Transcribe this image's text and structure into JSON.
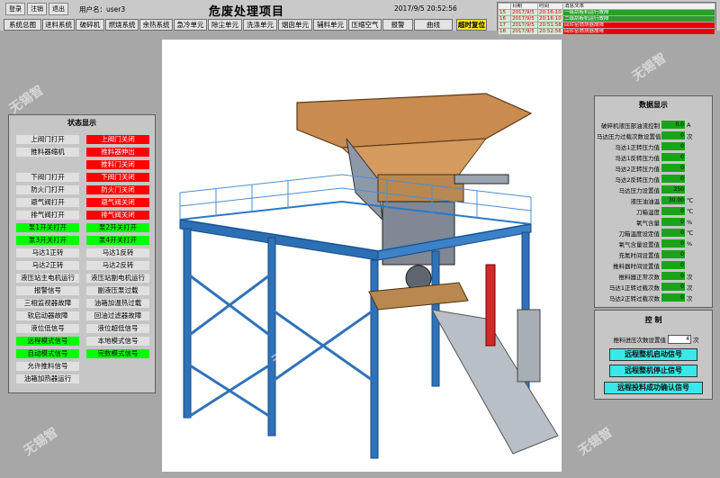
{
  "header": {
    "login": "登录",
    "logout": "注销",
    "exit": "退出",
    "user": "用户名：user3",
    "title": "危废处理项目",
    "datetime": "2017/9/5 20:52:56"
  },
  "nav": [
    "系统总图",
    "进料系统",
    "破碎机",
    "燃烧系统",
    "余热系统",
    "急冷单元",
    "除尘单元",
    "洗涤单元",
    "烟囱单元",
    "辅料单元",
    "压缩空气",
    "报警",
    "曲线",
    "超时复位"
  ],
  "alarms": {
    "headers": [
      "",
      "日期",
      "时间",
      "消息文本"
    ],
    "rows": [
      {
        "num": "15",
        "date": "2017/9/5",
        "time": "20:16:10",
        "msg": "一级刮板机运行故障"
      },
      {
        "num": "16",
        "date": "2017/9/5",
        "time": "20:16:10",
        "msg": "二级刮板机运行故障"
      },
      {
        "num": "17",
        "date": "2017/9/5",
        "time": "20:51:58",
        "msg": "回转窑燃烧器故障"
      },
      {
        "num": "18",
        "date": "2017/9/5",
        "time": "20:52:56",
        "msg": "回转窑燃烧器故障"
      }
    ]
  },
  "status_panel": {
    "title": "状态显示",
    "left": [
      "上阀门打开",
      "推料器缩机",
      "",
      "下阀门打开",
      "防火门打开",
      "避气阀打开",
      "排气阀打开",
      "泵1开关打开",
      "泵3开关打开",
      "马达1正转",
      "马达2正转",
      "液压站主电机运行",
      "报警信号",
      "三相监视器故障",
      "软启动器故障",
      "液位低信号",
      "远程模式信号",
      "自动模式信号",
      "允许推料信号",
      "油箱加热器运行"
    ],
    "right": [
      "上阀门关闭",
      "推料器伸出",
      "推料门关闭",
      "下阀门关闭",
      "防火门关闭",
      "避气阀关闭",
      "排气阀关闭",
      "泵2开关打开",
      "泵4开关打开",
      "马达1反转",
      "马达2反转",
      "液压站副电机运行",
      "副液压泵过载",
      "油箱加温热过载",
      "回油过滤器故障",
      "液位超低信号",
      "本地模式信号",
      "完数模式信号",
      "",
      ""
    ]
  },
  "data_panel": {
    "title": "数据显示",
    "rows": [
      {
        "label": "破碎机液压部油流控制",
        "value": "0.0",
        "unit": "A"
      },
      {
        "label": "马达压力过载次数设置值",
        "value": "0",
        "unit": "次"
      },
      {
        "label": "马达1正转压力值",
        "value": "0",
        "unit": ""
      },
      {
        "label": "马达1反转压力值",
        "value": "0",
        "unit": ""
      },
      {
        "label": "马达2正转压力值",
        "value": "0",
        "unit": ""
      },
      {
        "label": "马达2反转压力值",
        "value": "0",
        "unit": ""
      },
      {
        "label": "马达压力设置值",
        "value": "250",
        "unit": ""
      },
      {
        "label": "液压油油温",
        "value": "30.00",
        "unit": "℃"
      },
      {
        "label": "刀箱温度",
        "value": "0",
        "unit": "℃"
      },
      {
        "label": "氧气含量",
        "value": "0",
        "unit": "%"
      },
      {
        "label": "刀箱温度设定值",
        "value": "0",
        "unit": "℃"
      },
      {
        "label": "氧气含量设置值",
        "value": "0",
        "unit": "%"
      },
      {
        "label": "充氮时间设置值",
        "value": "0",
        "unit": ""
      },
      {
        "label": "推料器时间设置值",
        "value": "0",
        "unit": ""
      },
      {
        "label": "推料器正常次数",
        "value": "0",
        "unit": "次"
      },
      {
        "label": "马达1正转过载次数",
        "value": "0",
        "unit": "次"
      },
      {
        "label": "马达2正转过载次数",
        "value": "0",
        "unit": "次"
      }
    ]
  },
  "control_panel": {
    "title": "控 制",
    "input_label": "推料进压次数设置值",
    "input_value": "4",
    "input_unit": "次",
    "buttons": [
      "远程整机启动信号",
      "远程整机停止信号",
      "远程投料成功确认信号"
    ]
  },
  "watermark": "无锡智"
}
